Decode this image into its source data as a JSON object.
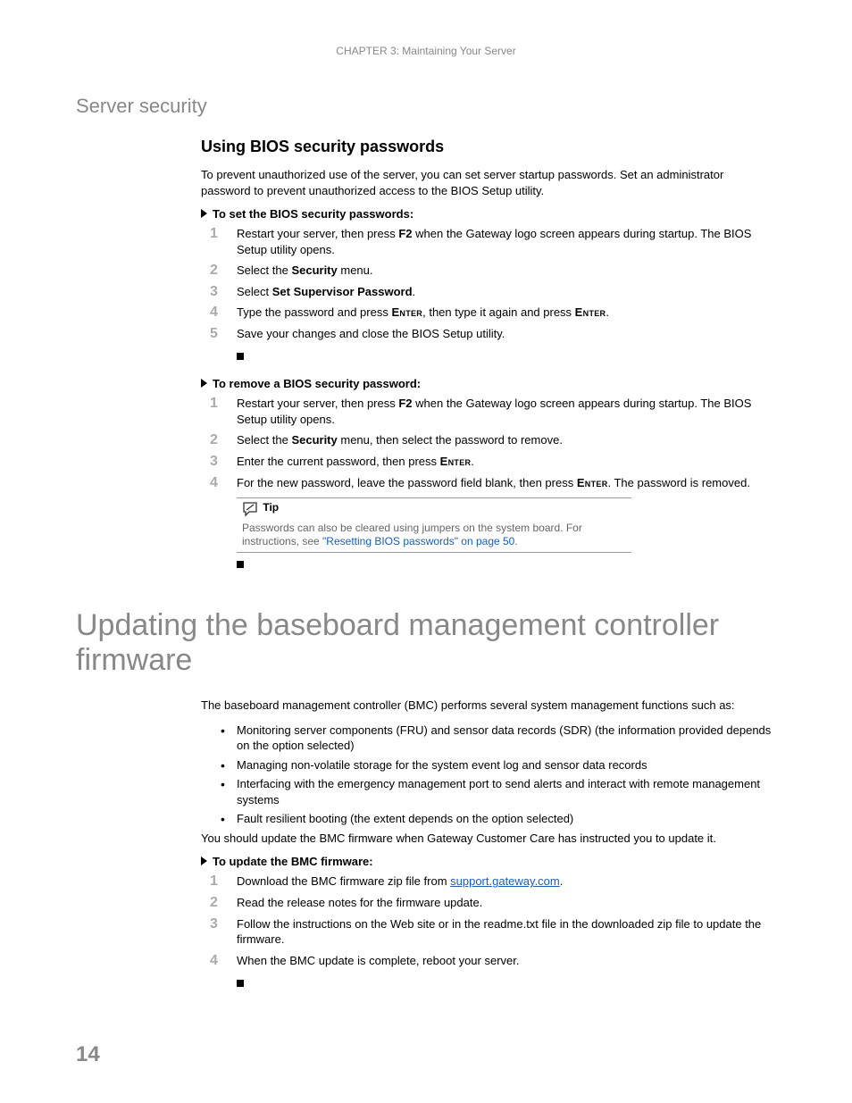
{
  "header": {
    "chapter_label": "CHAPTER 3: Maintaining Your Server"
  },
  "sec1": {
    "title": "Server security",
    "sub_title": "Using BIOS security passwords",
    "intro": "To prevent unauthorized use of the server, you can set server startup passwords. Set an administrator password to prevent unauthorized access to the BIOS Setup utility.",
    "task1_title": "To set the BIOS security passwords:",
    "task1": {
      "s1_a": "Restart your server, then press ",
      "s1_key": "F2",
      "s1_b": " when the Gateway logo screen appears during startup. The BIOS Setup utility opens.",
      "s2_a": "Select the ",
      "s2_b": "Security",
      "s2_c": " menu.",
      "s3_a": "Select ",
      "s3_b": "Set Supervisor Password",
      "s3_c": ".",
      "s4_a": "Type the password and press ",
      "s4_key1": "Enter",
      "s4_b": ", then type it again and press ",
      "s4_key2": "Enter",
      "s4_c": ".",
      "s5": "Save your changes and close the BIOS Setup utility."
    },
    "task2_title": "To remove a BIOS security password:",
    "task2": {
      "s1_a": "Restart your server, then press ",
      "s1_key": "F2",
      "s1_b": " when the Gateway logo screen appears during startup. The BIOS Setup utility opens.",
      "s2_a": "Select the ",
      "s2_b": "Security",
      "s2_c": " menu, then select the password to remove.",
      "s3_a": "Enter the current password, then press ",
      "s3_key": "Enter",
      "s3_b": ".",
      "s4_a": "For the new password, leave the password field blank, then press ",
      "s4_key": "Enter",
      "s4_b": ". The password is removed."
    },
    "tip": {
      "label": "Tip",
      "text_a": "Passwords can also be cleared using jumpers on the system board. For instructions, see ",
      "link_text": "\"Resetting BIOS passwords\" on page 50",
      "text_b": "."
    }
  },
  "sec2": {
    "title": "Updating the baseboard management controller firmware",
    "intro": "The baseboard management controller (BMC) performs several system management functions such as:",
    "bullets": {
      "b1": "Monitoring server components (FRU) and sensor data records (SDR) (the information provided depends on the option selected)",
      "b2": "Managing non-volatile storage for the system event log and sensor data records",
      "b3": "Interfacing with the emergency management port to send alerts and interact with remote management systems",
      "b4": "Fault resilient booting (the extent depends on the option selected)"
    },
    "intro2": "You should update the BMC firmware when Gateway Customer Care has instructed you to update it.",
    "task_title": "To update the BMC firmware:",
    "task": {
      "s1_a": "Download the BMC firmware zip file from ",
      "s1_link": "support.gateway.com",
      "s1_b": ".",
      "s2": "Read the release notes for the firmware update.",
      "s3": "Follow the instructions on the Web site or in the readme.txt file in the downloaded zip file to update the firmware.",
      "s4": "When the BMC update is complete, reboot your server."
    }
  },
  "page_number": "14"
}
